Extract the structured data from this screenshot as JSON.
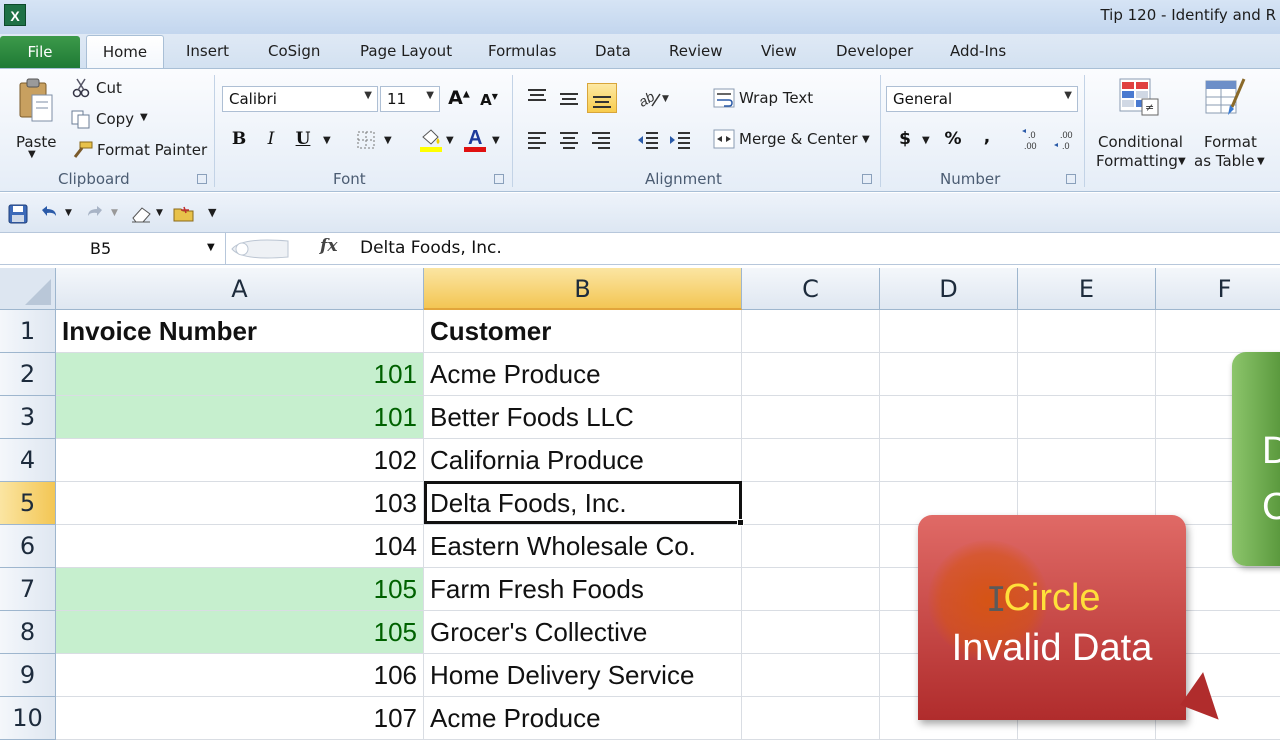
{
  "window": {
    "title": "Tip 120 - Identify and R"
  },
  "tabs": {
    "file": "File",
    "home": "Home",
    "insert": "Insert",
    "cosign": "CoSign",
    "page_layout": "Page Layout",
    "formulas": "Formulas",
    "data": "Data",
    "review": "Review",
    "view": "View",
    "developer": "Developer",
    "addins": "Add-Ins"
  },
  "clipboard": {
    "paste": "Paste",
    "cut": "Cut",
    "copy": "Copy",
    "format_painter": "Format Painter",
    "label": "Clipboard"
  },
  "font": {
    "name": "Calibri",
    "size": "11",
    "bold": "B",
    "italic": "I",
    "underline": "U",
    "label": "Font"
  },
  "alignment": {
    "wrap_text": "Wrap Text",
    "merge_center": "Merge & Center",
    "label": "Alignment"
  },
  "number": {
    "format": "General",
    "currency": "$",
    "percent": "%",
    "comma": ",",
    "label": "Number"
  },
  "styles": {
    "conditional_line1": "Conditional",
    "conditional_line2": "Formatting",
    "format_line1": "Format",
    "format_line2": "as Table"
  },
  "formula_bar": {
    "name_box": "B5",
    "fx": "fx",
    "formula": "Delta Foods, Inc."
  },
  "colors": {
    "accent": "#1e7145",
    "selected_header": "#f3c654",
    "duplicate_fill": "#c6efce",
    "duplicate_text": "#006100",
    "callout_red": "#b02c2c",
    "callout_green": "#4f8f33",
    "highlight_text": "#ffe03a"
  },
  "sheet": {
    "columns": [
      "A",
      "B",
      "C",
      "D",
      "E",
      "F"
    ],
    "rows": [
      "1",
      "2",
      "3",
      "4",
      "5",
      "6",
      "7",
      "8",
      "9",
      "10"
    ],
    "headers": {
      "a1": "Invoice Number",
      "b1": "Customer"
    },
    "data": [
      {
        "invoice": "101",
        "customer": "Acme Produce",
        "duplicate": true
      },
      {
        "invoice": "101",
        "customer": "Better Foods LLC",
        "duplicate": true
      },
      {
        "invoice": "102",
        "customer": "California Produce",
        "duplicate": false
      },
      {
        "invoice": "103",
        "customer": "Delta Foods, Inc.",
        "duplicate": false
      },
      {
        "invoice": "104",
        "customer": "Eastern Wholesale Co.",
        "duplicate": false
      },
      {
        "invoice": "105",
        "customer": "Farm Fresh Foods",
        "duplicate": true
      },
      {
        "invoice": "105",
        "customer": "Grocer's Collective",
        "duplicate": true
      },
      {
        "invoice": "106",
        "customer": "Home Delivery Service",
        "duplicate": false
      },
      {
        "invoice": "107",
        "customer": "Acme Produce",
        "duplicate": false
      }
    ],
    "active_cell": "B5"
  },
  "callouts": {
    "red_line1": "Circle",
    "red_line2": "Invalid Data",
    "green_line1": "D",
    "green_line2": "C"
  }
}
